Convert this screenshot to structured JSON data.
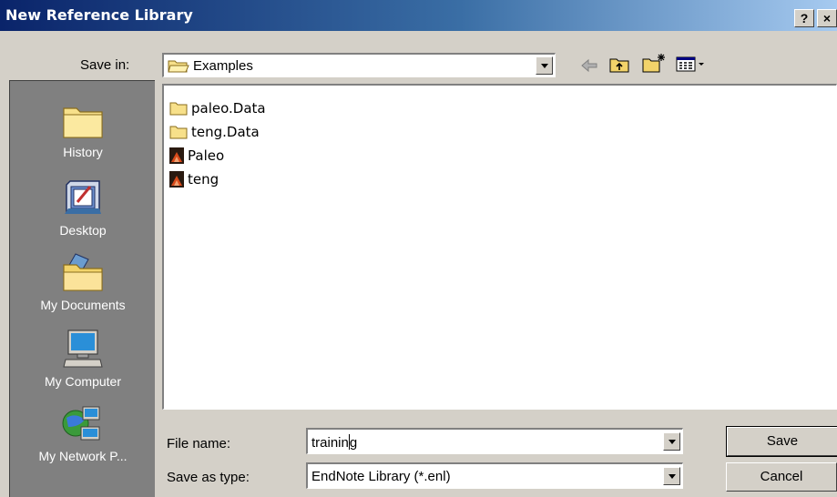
{
  "window": {
    "title": "New Reference Library",
    "help_label": "?",
    "close_label": "×"
  },
  "toolbar": {
    "save_in_label": "Save in:",
    "save_in_value": "Examples"
  },
  "places": [
    {
      "label": "History",
      "icon": "history-folder-icon"
    },
    {
      "label": "Desktop",
      "icon": "desktop-icon"
    },
    {
      "label": "My Documents",
      "icon": "my-documents-folder-icon"
    },
    {
      "label": "My Computer",
      "icon": "my-computer-icon"
    },
    {
      "label": "My Network P...",
      "icon": "my-network-places-icon"
    }
  ],
  "files": [
    {
      "name": "paleo.Data",
      "type": "folder"
    },
    {
      "name": "teng.Data",
      "type": "folder"
    },
    {
      "name": "Paleo",
      "type": "endnote-library"
    },
    {
      "name": "teng",
      "type": "endnote-library"
    }
  ],
  "form": {
    "file_name_label": "File name:",
    "file_name_before_caret": "trainin",
    "file_name_after_caret": "g",
    "save_as_type_label": "Save as type:",
    "save_as_type_value": "EndNote Library (*.enl)"
  },
  "buttons": {
    "save": "Save",
    "cancel": "Cancel"
  }
}
